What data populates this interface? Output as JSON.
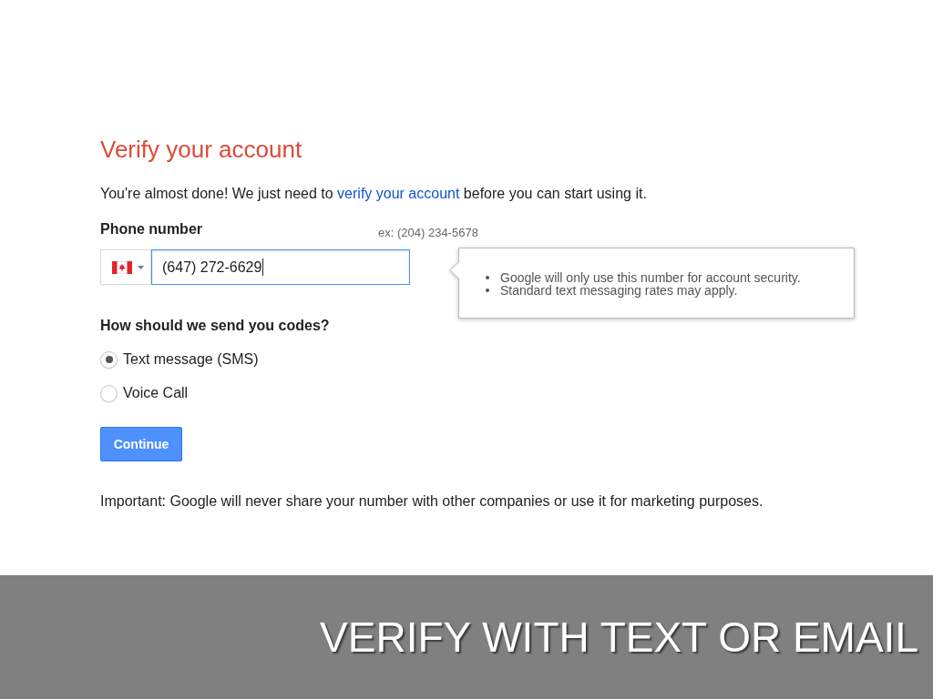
{
  "form": {
    "title": "Verify your account",
    "intro": {
      "text_before": "You're almost done! We just need to",
      "link": "verify your account",
      "text_after": "before you can start using it."
    },
    "phone": {
      "label": "Phone number",
      "example": "ex: (204) 234-5678",
      "value": "(647) 272-6629",
      "focused": true
    },
    "tooltip": {
      "items": [
        "Google will only use this number for account security.",
        "Standard text messaging rates may apply."
      ]
    },
    "delivery": {
      "question": "How should we send you codes?",
      "options": [
        {
          "label": "Text message (SMS)",
          "selected": true
        },
        {
          "label": "Voice Call",
          "selected": false
        }
      ]
    },
    "continue_button": {
      "label": "Continue"
    },
    "notice": "Important: Google will never share your number with other companies or use it for marketing purposes."
  },
  "caption": "VERIFY WITH TEXT OR EMAIL"
}
